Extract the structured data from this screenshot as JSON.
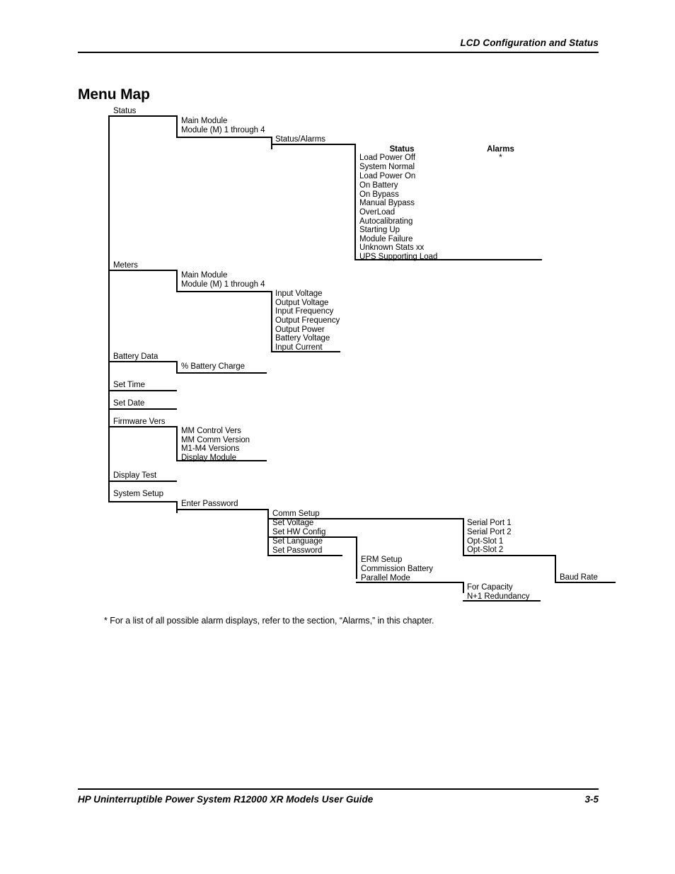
{
  "running_head": "LCD Configuration and Status",
  "page_title": "Menu Map",
  "footer": {
    "text": "HP Uninterruptible Power System R12000 XR Models User Guide",
    "page_number": "3-5"
  },
  "footnote": "* For a list of all possible alarm displays, refer to the section, “Alarms,” in this chapter.",
  "menu": {
    "root_items": [
      {
        "label": "Status"
      },
      {
        "label": "Meters"
      },
      {
        "label": "Battery Data"
      },
      {
        "label": "Set Time"
      },
      {
        "label": "Set Date"
      },
      {
        "label": "Firmware Vers"
      },
      {
        "label": "Display Test"
      },
      {
        "label": "System Setup"
      }
    ],
    "status_level2": [
      "Main Module",
      "Module (M) 1 through 4"
    ],
    "status_level3": [
      "Status/Alarms"
    ],
    "status_table": {
      "col_status_header": "Status",
      "col_alarms_header": "Alarms",
      "col_alarms_note": "*",
      "status_values": [
        "Load Power Off",
        "System Normal",
        "Load Power On",
        "On Battery",
        "On Bypass",
        "Manual Bypass",
        "OverLoad",
        "Autocalibrating",
        "Starting Up",
        "Module Failure",
        "Unknown Stats xx",
        "UPS Supporting Load"
      ]
    },
    "meters_level2": [
      "Main Module",
      "Module (M) 1 through 4"
    ],
    "meters_level3": [
      "Input Voltage",
      "Output Voltage",
      "Input Frequency",
      "Output Frequency",
      "Output Power",
      "Battery Voltage",
      "Input Current"
    ],
    "battery_data_level2": [
      "% Battery Charge"
    ],
    "firmware_level2": [
      "MM Control Vers",
      "MM Comm Version",
      "M1-M4 Versions",
      "Display Module"
    ],
    "system_setup_level2": [
      "Enter Password"
    ],
    "system_setup_level3_a": [
      "Comm Setup"
    ],
    "system_setup_level3_b": [
      "Set Voltage",
      "Set HW Config"
    ],
    "system_setup_level3_c": [
      "Set Language",
      "Set Password"
    ],
    "comm_setup_level4": [
      "Serial Port 1",
      "Serial Port 2",
      "Opt-Slot 1",
      "Opt-Slot 2"
    ],
    "baud_rate_level5": [
      "Baud Rate"
    ],
    "hw_config_level4": [
      "ERM Setup",
      "Commission Battery",
      "Parallel Mode"
    ],
    "parallel_mode_level5": [
      "For Capacity",
      "N+1 Redundancy"
    ]
  }
}
